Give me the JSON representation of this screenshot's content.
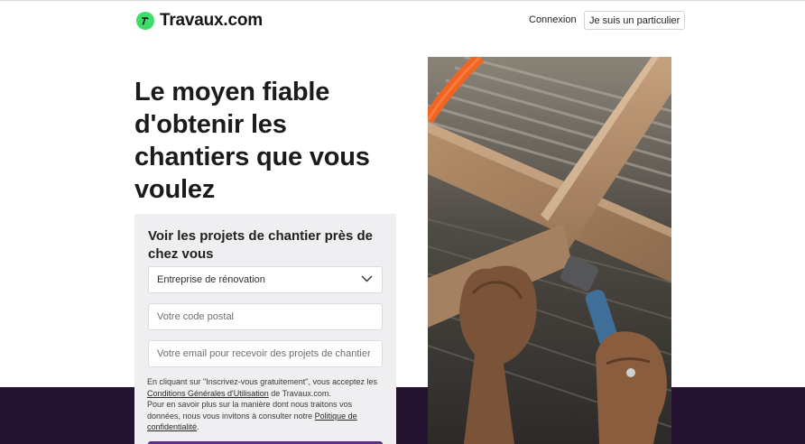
{
  "header": {
    "logo_text": "Travaux.com",
    "login_label": "Connexion",
    "particulier_label": "Je suis un particulier"
  },
  "hero": {
    "title_lines": [
      "Le moyen fiable",
      "d'obtenir les",
      "chantiers que vous",
      "voulez"
    ]
  },
  "form": {
    "heading": "Voir les projets de chantier près de chez vous",
    "trade_select_value": "Entreprise de rénovation",
    "postal_placeholder": "Votre code postal",
    "email_placeholder": "Votre email pour recevoir des projets de chantier",
    "legal": {
      "part1": "En cliquant sur \"Inscrivez-vous gratuitement\", vous acceptez les ",
      "cgu_link": "Conditions Générales d'Utilisation",
      "part2": " de Travaux.com.",
      "part3": "Pour en savoir plus sur la manière dont nous traitons vos données, nous vous invitons à consulter notre ",
      "privacy_link": "Politique de confidentialité",
      "part4": "."
    }
  },
  "colors": {
    "logo_green": "#3ddc6b",
    "dark_band": "#241330",
    "submit_purple": "#5b2f8a",
    "card_bg": "#efeff2"
  },
  "icons": {
    "logo": "hammer-icon",
    "select": "chevron-down-icon"
  }
}
